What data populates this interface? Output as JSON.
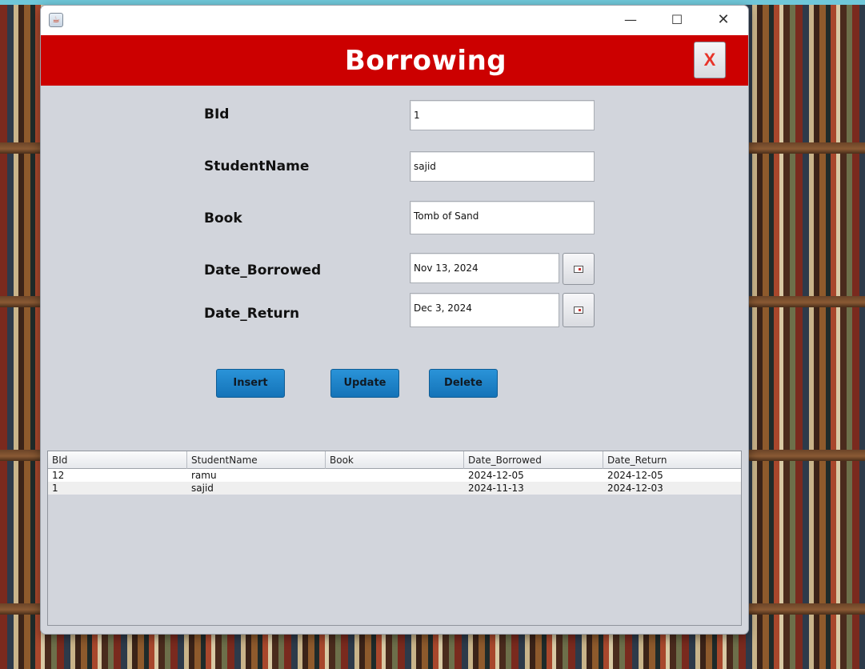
{
  "window": {
    "title": "",
    "minimize_glyph": "—",
    "maximize_glyph": "☐",
    "close_glyph": "✕"
  },
  "header": {
    "title": "Borrowing",
    "close_label": "X",
    "background_color": "#cc0000"
  },
  "form": {
    "bid_label": "BId",
    "bid_value": "1",
    "student_label": "StudentName",
    "student_value": "sajid",
    "book_label": "Book",
    "book_value": "Tomb of Sand",
    "date_borrowed_label": "Date_Borrowed",
    "date_borrowed_value": "Nov 13, 2024",
    "date_return_label": "Date_Return",
    "date_return_value": "Dec 3, 2024"
  },
  "actions": {
    "insert_label": "Insert",
    "update_label": "Update",
    "delete_label": "Delete",
    "button_color": "#1a7fc8"
  },
  "table": {
    "columns": [
      "BId",
      "StudentName",
      "Book",
      "Date_Borrowed",
      "Date_Return"
    ],
    "rows": [
      [
        "12",
        "ramu",
        "",
        "2024-12-05",
        "2024-12-05"
      ],
      [
        "1",
        "sajid",
        "",
        "2024-11-13",
        "2024-12-03"
      ]
    ]
  }
}
